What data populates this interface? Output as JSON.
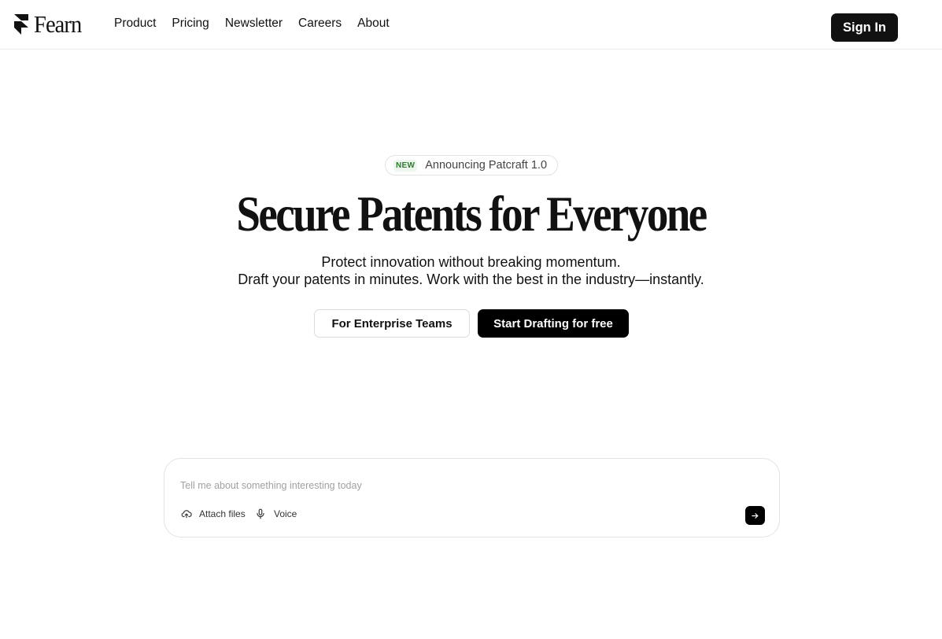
{
  "brand": {
    "name": "Fearn"
  },
  "nav": {
    "links": [
      "Product",
      "Pricing",
      "Newsletter",
      "Careers",
      "About"
    ],
    "sign_in_label": "Sign In"
  },
  "announcement": {
    "badge": "NEW",
    "text": "Announcing Patcraft 1.0"
  },
  "hero": {
    "title": "Secure Patents for Everyone",
    "subtitle_line1": "Protect innovation without breaking momentum.",
    "subtitle_line2": "Draft your patents in minutes. Work with the best in the industry—instantly."
  },
  "cta": {
    "enterprise_label": "For Enterprise Teams",
    "start_label": "Start Drafting for free"
  },
  "prompt": {
    "placeholder": "Tell me about something interesting today",
    "value": "",
    "attach_label": "Attach files",
    "voice_label": "Voice",
    "attach_icon": "cloud-upload-icon",
    "voice_icon": "microphone-icon",
    "send_icon": "arrow-right-icon"
  },
  "colors": {
    "primary": "#111111",
    "background": "#ffffff",
    "badge_text": "#2d7a2d",
    "badge_bg": "#eef7ee",
    "border": "#e3e3e3"
  }
}
